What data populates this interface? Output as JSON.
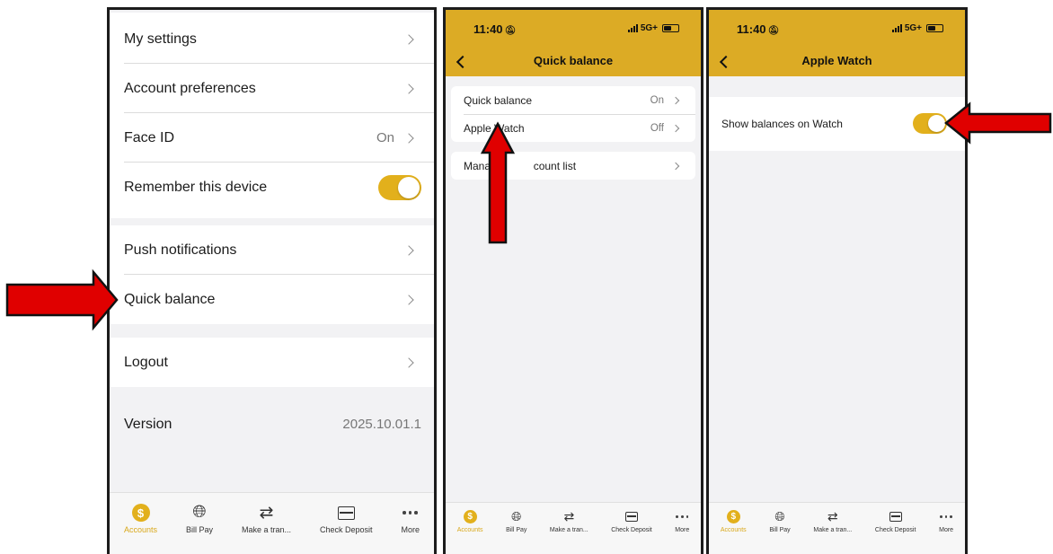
{
  "settings_screen": {
    "rows": [
      {
        "label": "My settings",
        "value": ""
      },
      {
        "label": "Account preferences",
        "value": ""
      },
      {
        "label": "Face ID",
        "value": "On"
      },
      {
        "label": "Remember this device",
        "value": ""
      },
      {
        "label": "Push notifications",
        "value": ""
      },
      {
        "label": "Quick balance",
        "value": ""
      },
      {
        "label": "Logout",
        "value": ""
      }
    ],
    "remember_device_toggle": "on",
    "version": {
      "label": "Version",
      "value": "2025.10.01.1"
    }
  },
  "quick_balance_screen": {
    "status": {
      "time": "11:40",
      "network": "5G+"
    },
    "title": "Quick balance",
    "rows": [
      {
        "label": "Quick balance",
        "value": "On"
      },
      {
        "label": "Apple Watch",
        "value": "Off"
      },
      {
        "label": "Manage account list",
        "value": ""
      }
    ],
    "manage_visible": {
      "start": "Manag",
      "end": "count list"
    }
  },
  "apple_watch_screen": {
    "status": {
      "time": "11:40",
      "network": "5G+"
    },
    "title": "Apple Watch",
    "row": {
      "label": "Show balances on Watch"
    },
    "toggle": "on"
  },
  "tabbar": {
    "items": [
      {
        "label": "Accounts",
        "icon": "dollar-icon",
        "active": true
      },
      {
        "label": "Bill Pay",
        "icon": "globe-icon",
        "active": false
      },
      {
        "label": "Make a tran...",
        "icon": "transfer-icon",
        "active": false
      },
      {
        "label": "Check Deposit",
        "icon": "check-deposit-icon",
        "active": false
      },
      {
        "label": "More",
        "icon": "more-icon",
        "active": false
      }
    ]
  },
  "colors": {
    "accent_gold": "#dcab25",
    "toggle_on": "#e2b01c",
    "arrow_red": "#e00000"
  }
}
